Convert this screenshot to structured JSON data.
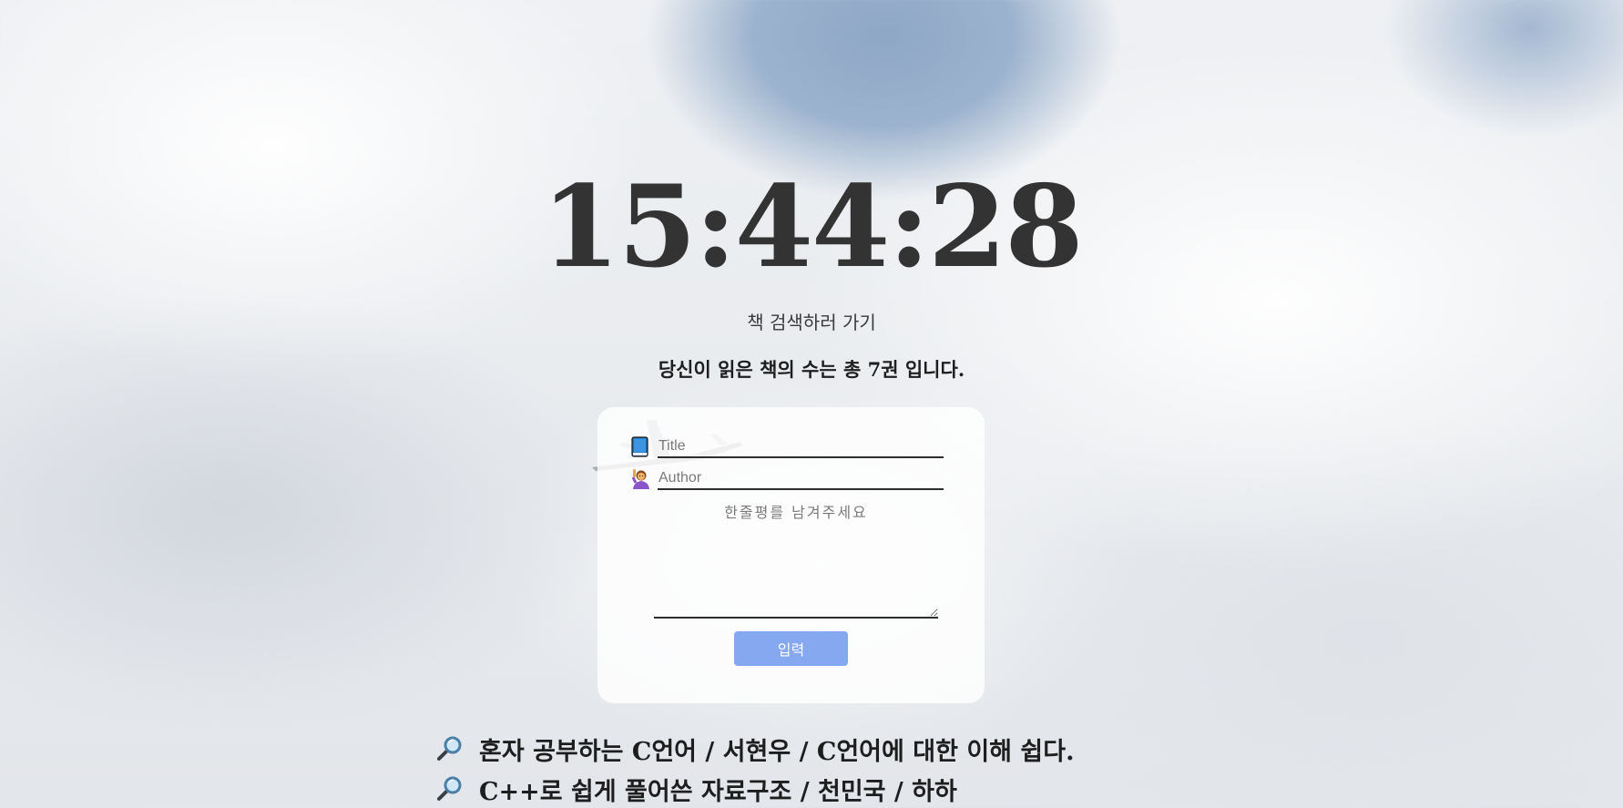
{
  "clock": {
    "time": "15:44:28"
  },
  "search_link": {
    "label": "책 검색하러 가기"
  },
  "read_count": {
    "text": "당신이 읽은 책의 수는 총 7권 입니다."
  },
  "form": {
    "title_placeholder": "Title",
    "title_value": "",
    "author_placeholder": "Author",
    "author_value": "",
    "review_placeholder": "한줄평를 남겨주세요",
    "review_value": "",
    "submit_label": "입력",
    "icons": {
      "title": "book-icon",
      "author": "person-raising-hand-icon"
    }
  },
  "books": [
    {
      "icon": "magnifier-icon",
      "text": "혼자 공부하는 C언어 / 서현우 / C언어에 대한 이해 쉽다."
    },
    {
      "icon": "magnifier-icon",
      "text": "C++로 쉽게 풀어쓴 자료구조 / 천민국 / 하하"
    }
  ],
  "colors": {
    "clock_text": "#333333",
    "submit_button": "#86a8f0",
    "card_background": "rgba(255,255,255,0.82)",
    "sky_blue": "#8ea7c6"
  }
}
